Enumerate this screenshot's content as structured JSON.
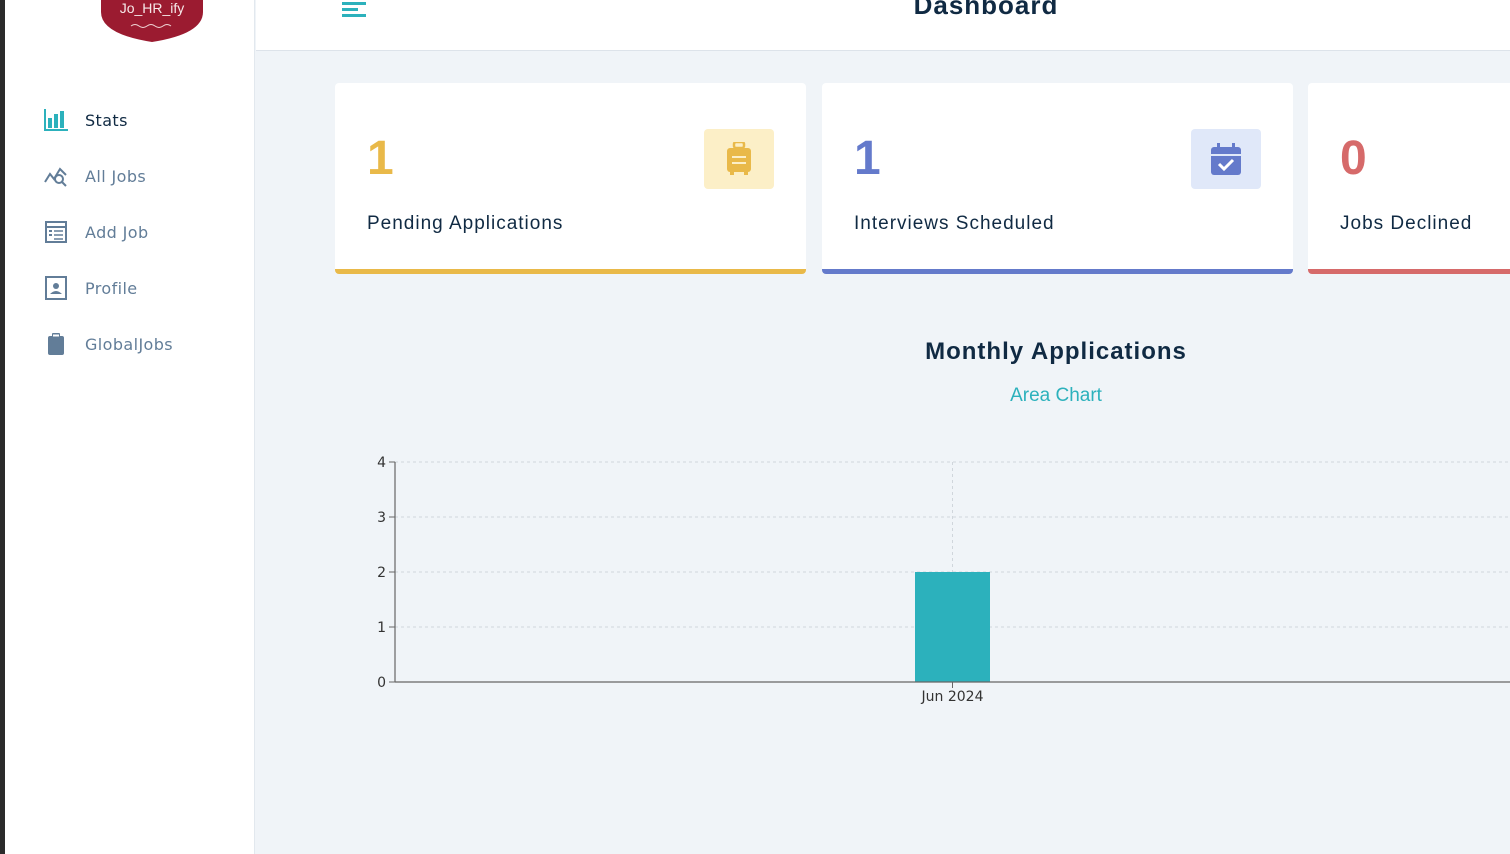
{
  "app": {
    "logo_text": "Jo_HR_ify"
  },
  "header": {
    "title": "Dashboard"
  },
  "sidebar": {
    "items": [
      {
        "label": "Stats",
        "icon": "bar-chart-icon",
        "active": true
      },
      {
        "label": "All Jobs",
        "icon": "query-stats-icon",
        "active": false
      },
      {
        "label": "Add Job",
        "icon": "form-icon",
        "active": false
      },
      {
        "label": "Profile",
        "icon": "id-card-icon",
        "active": false
      },
      {
        "label": "GlobalJobs",
        "icon": "clipboard-icon",
        "active": false
      }
    ]
  },
  "stats": [
    {
      "count": "1",
      "label": "Pending Applications",
      "icon": "suitcase-icon",
      "color": "#e9b949"
    },
    {
      "count": "1",
      "label": "Interviews Scheduled",
      "icon": "calendar-check-icon",
      "color": "#647acb"
    },
    {
      "count": "0",
      "label": "Jobs Declined",
      "icon": "bug-icon",
      "color": "#d66a6a"
    }
  ],
  "chart_section": {
    "title": "Monthly Applications",
    "toggle_label": "Area Chart"
  },
  "colors": {
    "accent": "#2cb1bc",
    "pending": "#e9b949",
    "interview": "#647acb",
    "declined": "#d66a6a"
  },
  "chart_data": {
    "type": "bar",
    "categories": [
      "Jun 2024"
    ],
    "values": [
      2
    ],
    "title": "Monthly Applications",
    "xlabel": "",
    "ylabel": "",
    "ylim": [
      0,
      4
    ],
    "yticks": [
      0,
      1,
      2,
      3,
      4
    ],
    "grid": true,
    "bar_color": "#2cb1bc"
  }
}
